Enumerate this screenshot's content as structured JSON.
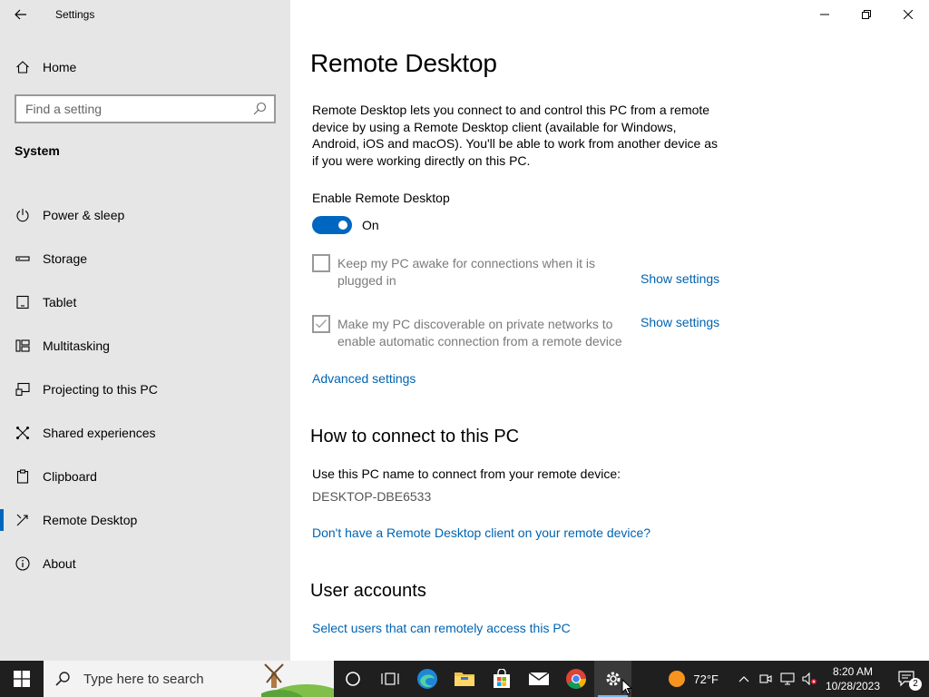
{
  "window": {
    "title": "Settings"
  },
  "sidebar": {
    "home_label": "Home",
    "search_placeholder": "Find a setting",
    "section": "System",
    "items": [
      {
        "label": "Power & sleep",
        "icon": "power-icon"
      },
      {
        "label": "Storage",
        "icon": "storage-icon"
      },
      {
        "label": "Tablet",
        "icon": "tablet-icon"
      },
      {
        "label": "Multitasking",
        "icon": "multitasking-icon"
      },
      {
        "label": "Projecting to this PC",
        "icon": "projecting-icon"
      },
      {
        "label": "Shared experiences",
        "icon": "shared-experiences-icon"
      },
      {
        "label": "Clipboard",
        "icon": "clipboard-icon"
      },
      {
        "label": "Remote Desktop",
        "icon": "remote-desktop-icon",
        "selected": true
      },
      {
        "label": "About",
        "icon": "info-icon"
      }
    ]
  },
  "main": {
    "title": "Remote Desktop",
    "description": "Remote Desktop lets you connect to and control this PC from a remote device by using a Remote Desktop client (available for Windows, Android, iOS and macOS). You'll be able to work from another device as if you were working directly on this PC.",
    "enable_label": "Enable Remote Desktop",
    "toggle_state": "On",
    "keep_awake_label": "Keep my PC awake for connections when it is plugged in",
    "keep_awake_checked": false,
    "discoverable_label": "Make my PC discoverable on private networks to enable automatic connection from a remote device",
    "discoverable_checked": true,
    "show_settings_1": "Show settings",
    "show_settings_2": "Show settings",
    "advanced_link": "Advanced settings",
    "connect_heading": "How to connect to this PC",
    "connect_text": "Use this PC name to connect from your remote device:",
    "pc_name": "DESKTOP-DBE6533",
    "client_link": "Don't have a Remote Desktop client on your remote device?",
    "accounts_heading": "User accounts",
    "users_link": "Select users that can remotely access this PC"
  },
  "taskbar": {
    "search_placeholder": "Type here to search",
    "weather": "72°F",
    "time": "8:20 AM",
    "date": "10/28/2023",
    "notification_count": "2"
  },
  "colors": {
    "accent": "#0067c0",
    "link": "#0063b1",
    "sidebar_bg": "#e6e6e6",
    "taskbar_bg": "#1f1f1f"
  }
}
